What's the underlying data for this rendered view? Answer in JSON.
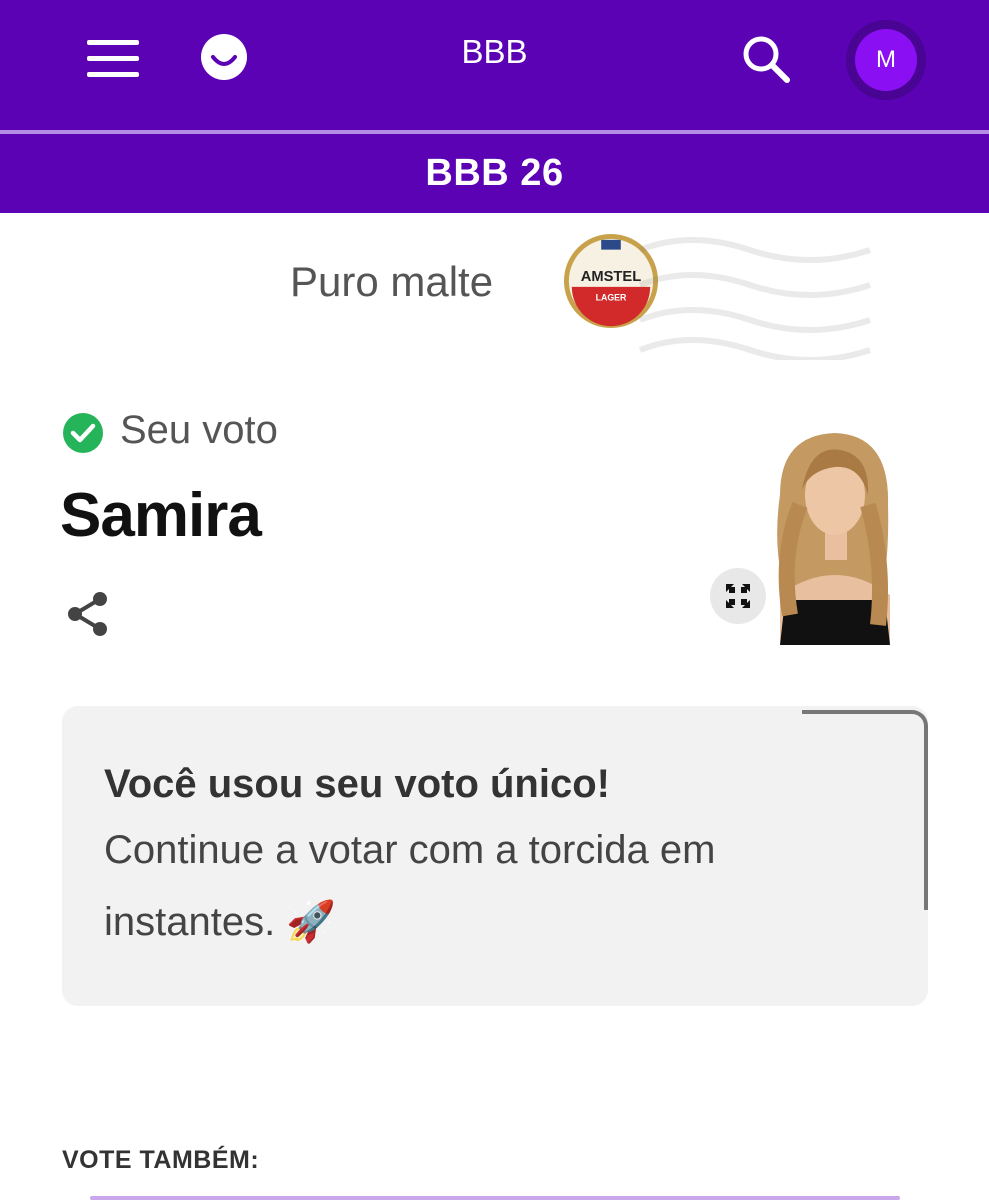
{
  "header": {
    "title": "BBB",
    "section_title": "BBB 26",
    "avatar_initial": "M",
    "accent_color": "#5a02b4"
  },
  "sponsor": {
    "tagline": "Puro malte",
    "logo_text_top": "AMSTEL",
    "logo_text_bottom": "LAGER"
  },
  "vote": {
    "status_label": "Seu voto",
    "candidate_name": "Samira"
  },
  "notice": {
    "title": "Você usou seu voto único!",
    "body": "Continue a votar com a torcida em instantes. 🚀"
  },
  "footer": {
    "also_vote_label": "VOTE TAMBÉM:"
  }
}
